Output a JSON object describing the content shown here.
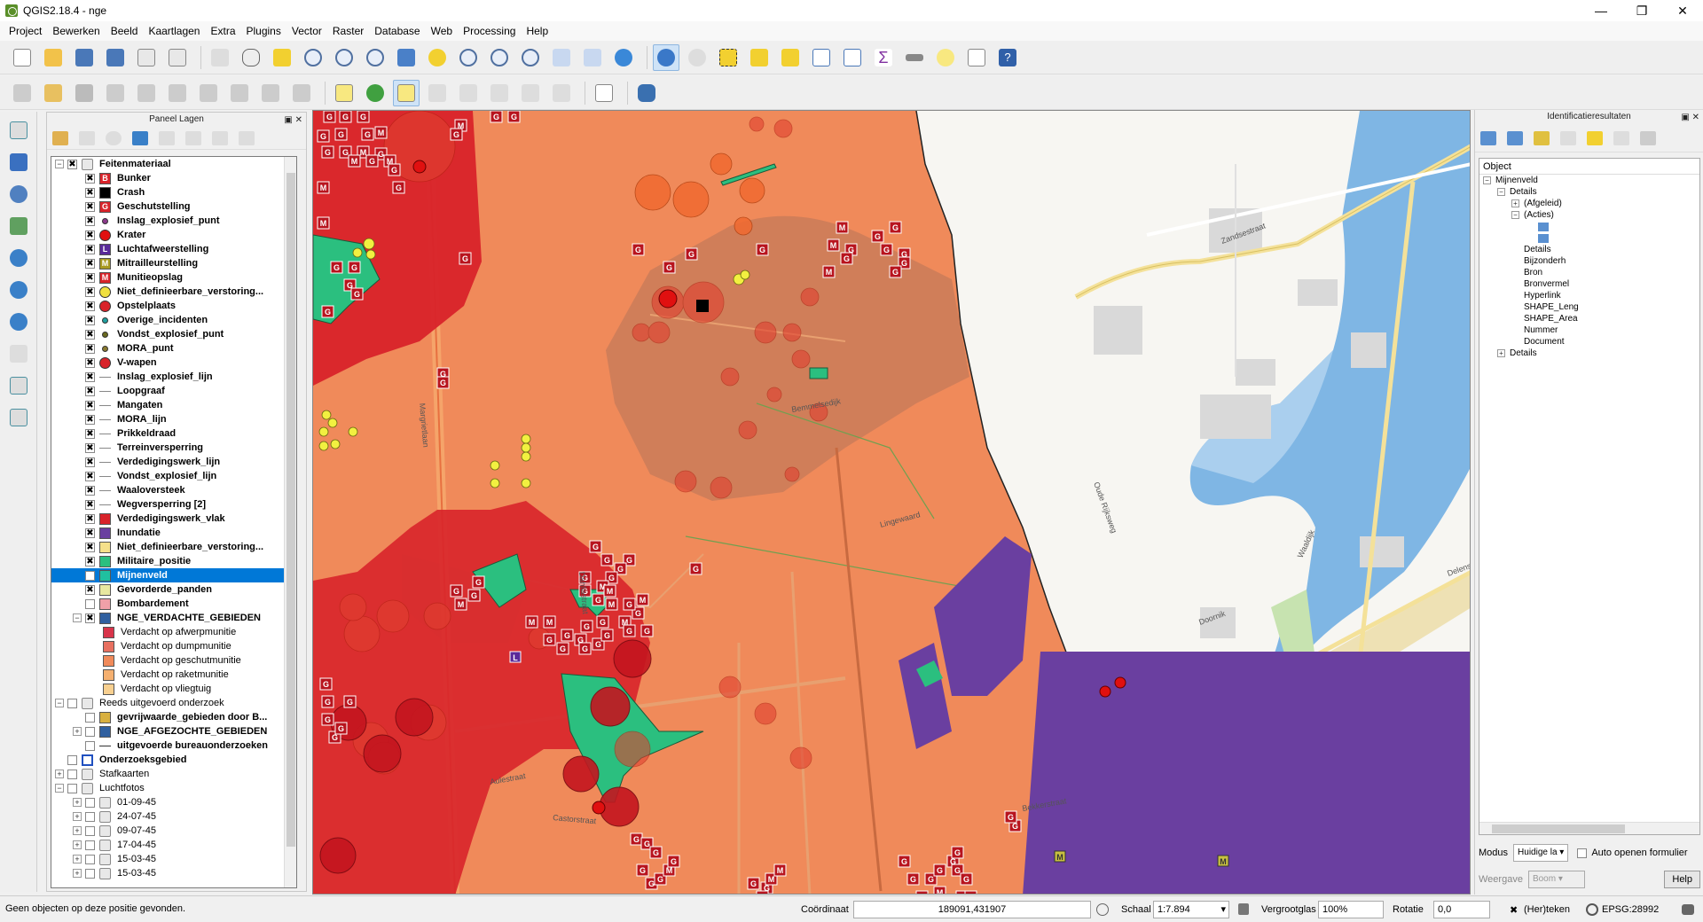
{
  "window": {
    "title": "QGIS2.18.4 - nge"
  },
  "menu": [
    "Project",
    "Bewerken",
    "Beeld",
    "Kaartlagen",
    "Extra",
    "Plugins",
    "Vector",
    "Raster",
    "Database",
    "Web",
    "Processing",
    "Help"
  ],
  "layers_panel": {
    "title": "Paneel Lagen",
    "tree": [
      {
        "label": "Feitenmateriaal",
        "level": 0,
        "type": "group",
        "expand": "−",
        "checked": true
      },
      {
        "label": "Bunker",
        "level": 1,
        "sym": "B",
        "color": "#d8232a",
        "checked": true
      },
      {
        "label": "Crash",
        "level": 1,
        "sym": "",
        "color": "#000000",
        "checked": true
      },
      {
        "label": "Geschutstelling",
        "level": 1,
        "sym": "G",
        "color": "#d8232a",
        "checked": true
      },
      {
        "label": "Inslag_explosief_punt",
        "level": 1,
        "sym": "•",
        "color": "#8c3a8c",
        "checked": true
      },
      {
        "label": "Krater",
        "level": 1,
        "sym": "●",
        "color": "#e01010",
        "checked": true
      },
      {
        "label": "Luchtafweerstelling",
        "level": 1,
        "sym": "L",
        "color": "#5a2a9a",
        "checked": true
      },
      {
        "label": "Mitrailleurstelling",
        "level": 1,
        "sym": "M",
        "color": "#a89a20",
        "checked": true
      },
      {
        "label": "Munitieopslag",
        "level": 1,
        "sym": "M",
        "color": "#d8232a",
        "checked": true
      },
      {
        "label": "Niet_definieerbare_verstoring...",
        "level": 1,
        "sym": "●",
        "color": "#f0e040",
        "checked": true
      },
      {
        "label": "Opstelplaats",
        "level": 1,
        "sym": "●",
        "color": "#d8232a",
        "checked": true
      },
      {
        "label": "Overige_incidenten",
        "level": 1,
        "sym": "•",
        "color": "#20a0a0",
        "checked": true
      },
      {
        "label": "Vondst_explosief_punt",
        "level": 1,
        "sym": "•",
        "color": "#6a6a20",
        "checked": true
      },
      {
        "label": "MORA_punt",
        "level": 1,
        "sym": "•",
        "color": "#8a7a30",
        "checked": true
      },
      {
        "label": "V-wapen",
        "level": 1,
        "sym": "◎",
        "color": "#d8232a",
        "checked": true
      },
      {
        "label": "Inslag_explosief_lijn",
        "level": 1,
        "sym": "—",
        "color": "#888888",
        "checked": true
      },
      {
        "label": "Loopgraaf",
        "level": 1,
        "sym": "—",
        "color": "#888888",
        "checked": true
      },
      {
        "label": "Mangaten",
        "level": 1,
        "sym": "—",
        "color": "#888888",
        "checked": true
      },
      {
        "label": "MORA_lijn",
        "level": 1,
        "sym": "—",
        "color": "#888888",
        "checked": true
      },
      {
        "label": "Prikkeldraad",
        "level": 1,
        "sym": "—",
        "color": "#888888",
        "checked": true
      },
      {
        "label": "Terreinversperring",
        "level": 1,
        "sym": "—",
        "color": "#888888",
        "checked": true
      },
      {
        "label": "Verdedigingswerk_lijn",
        "level": 1,
        "sym": "—",
        "color": "#888888",
        "checked": true
      },
      {
        "label": "Vondst_explosief_lijn",
        "level": 1,
        "sym": "—",
        "color": "#888888",
        "checked": true
      },
      {
        "label": "Waaloversteek",
        "level": 1,
        "sym": "—",
        "color": "#888888",
        "checked": true
      },
      {
        "label": "Wegversperring [2]",
        "level": 1,
        "sym": "—",
        "color": "#888888",
        "checked": true
      },
      {
        "label": "Verdedigingswerk_vlak",
        "level": 1,
        "sym": "■",
        "color": "#d8232a",
        "checked": true
      },
      {
        "label": "Inundatie",
        "level": 1,
        "sym": "■",
        "color": "#6a3fa0",
        "checked": true
      },
      {
        "label": "Niet_definieerbare_verstoring...",
        "level": 1,
        "sym": "■",
        "color": "#f5e08a",
        "checked": true
      },
      {
        "label": "Militaire_positie",
        "level": 1,
        "sym": "■",
        "color": "#2bbf7f",
        "checked": true
      },
      {
        "label": "Mijnenveld",
        "level": 1,
        "sym": "■",
        "color": "#20c0a0",
        "checked": true,
        "selected": true
      },
      {
        "label": "Gevorderde_panden",
        "level": 1,
        "sym": "■",
        "color": "#e8e8a0",
        "checked": true
      },
      {
        "label": "Bombardement",
        "level": 1,
        "sym": "■",
        "color": "#f0a0a8",
        "checked": false
      },
      {
        "label": "NGE_VERDACHTE_GEBIEDEN",
        "level": 1,
        "type": "group",
        "expand": "−",
        "sym": "▦",
        "color": "#3060a0",
        "checked": true
      },
      {
        "label": "Verdacht op afwerpmunitie",
        "level": 2,
        "sym": "■",
        "color": "#d8344a",
        "plain": true
      },
      {
        "label": "Verdacht op dumpmunitie",
        "level": 2,
        "sym": "■",
        "color": "#e87060",
        "plain": true
      },
      {
        "label": "Verdacht op geschutmunitie",
        "level": 2,
        "sym": "■",
        "color": "#f08a5a",
        "plain": true
      },
      {
        "label": "Verdacht op raketmunitie",
        "level": 2,
        "sym": "■",
        "color": "#f5b070",
        "plain": true
      },
      {
        "label": "Verdacht op vliegtuig",
        "level": 2,
        "sym": "■",
        "color": "#f8d090",
        "plain": true
      },
      {
        "label": "Reeds uitgevoerd onderzoek",
        "level": 0,
        "type": "group",
        "expand": "−",
        "checked": false,
        "plain": true
      },
      {
        "label": "gevrijwaarde_gebieden door B...",
        "level": 1,
        "sym": "■",
        "color": "#d8b040",
        "checked": false
      },
      {
        "label": "NGE_AFGEZOCHTE_GEBIEDEN",
        "level": 1,
        "expand": "+",
        "sym": "▦",
        "color": "#3060a0",
        "checked": false
      },
      {
        "label": "uitgevoerde bureauonderzoeken",
        "level": 1,
        "sym": "—",
        "color": "#333333",
        "checked": false
      },
      {
        "label": "Onderzoeksgebied",
        "level": 0,
        "sym": "□",
        "color": "#2050c0",
        "checked": false
      },
      {
        "label": "Stafkaarten",
        "level": 0,
        "type": "group",
        "expand": "+",
        "checked": false,
        "plain": true
      },
      {
        "label": "Luchtfotos",
        "level": 0,
        "type": "group",
        "expand": "−",
        "checked": false,
        "plain": true
      },
      {
        "label": "01-09-45",
        "level": 1,
        "expand": "+",
        "checked": false,
        "plain": true
      },
      {
        "label": "24-07-45",
        "level": 1,
        "expand": "+",
        "checked": false,
        "plain": true
      },
      {
        "label": "09-07-45",
        "level": 1,
        "expand": "+",
        "checked": false,
        "plain": true
      },
      {
        "label": "17-04-45",
        "level": 1,
        "expand": "+",
        "checked": false,
        "plain": true
      },
      {
        "label": "15-03-45",
        "level": 1,
        "expand": "+",
        "checked": false,
        "plain": true
      },
      {
        "label": "15-03-45",
        "level": 1,
        "expand": "+",
        "checked": false,
        "plain": true
      }
    ]
  },
  "identify_panel": {
    "title": "Identificatieresultaten",
    "header": "Object",
    "tree": [
      {
        "label": "Mijnenveld",
        "level": 0,
        "expand": "−"
      },
      {
        "label": "Details",
        "level": 1,
        "expand": "−"
      },
      {
        "label": "(Afgeleid)",
        "level": 2,
        "expand": "+"
      },
      {
        "label": "(Acties)",
        "level": 2,
        "expand": "−"
      },
      {
        "label": "",
        "level": 3
      },
      {
        "label": "",
        "level": 3
      },
      {
        "label": "Details",
        "level": 2
      },
      {
        "label": "Bijzonderh",
        "level": 2
      },
      {
        "label": "Bron",
        "level": 2
      },
      {
        "label": "Bronvermel",
        "level": 2
      },
      {
        "label": "Hyperlink",
        "level": 2
      },
      {
        "label": "SHAPE_Leng",
        "level": 2
      },
      {
        "label": "SHAPE_Area",
        "level": 2
      },
      {
        "label": "Nummer",
        "level": 2
      },
      {
        "label": "Document",
        "level": 2
      },
      {
        "label": "Details",
        "level": 1,
        "expand": "+"
      }
    ],
    "modus_label": "Modus",
    "modus_value": "Huidige la",
    "auto_open_label": "Auto openen formulier",
    "weergave_label": "Weergave",
    "weergave_value": "Boom",
    "help_label": "Help"
  },
  "map": {
    "street_labels": [
      "Zandsestraat",
      "Waaldijk",
      "Oude Rijksweg",
      "Doornik",
      "Delensedijk",
      "Bekkerstraat",
      "Castorstraat",
      "Aulestraat",
      "Dahliastraat",
      "Margrietlaan",
      "Bemmelsedijk",
      "Lingewaard"
    ],
    "marker_letters": {
      "gun": "G",
      "munition": "M",
      "aa": "L"
    }
  },
  "status": {
    "message": "Geen objecten op deze positie gevonden.",
    "coord_label": "Coördinaat",
    "coord_value": "189091,431907",
    "scale_label": "Schaal",
    "scale_value": "1:7.894",
    "zoom_label": "Vergrootglas",
    "zoom_value": "100%",
    "rotation_label": "Rotatie",
    "rotation_value": "0,0",
    "render_label": "(Her)teken",
    "epsg": "EPSG:28992"
  }
}
